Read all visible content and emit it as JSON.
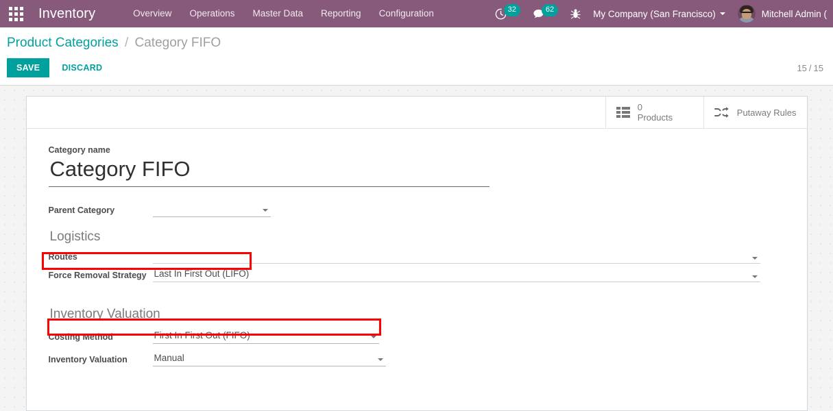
{
  "navbar": {
    "apps_icon": "apps-grid-icon",
    "brand": "Inventory",
    "menu": [
      {
        "label": "Overview"
      },
      {
        "label": "Operations"
      },
      {
        "label": "Master Data"
      },
      {
        "label": "Reporting"
      },
      {
        "label": "Configuration"
      }
    ],
    "tray": {
      "activities_icon": "clock-icon",
      "activities_count": "32",
      "messages_icon": "chat-bubble-icon",
      "messages_count": "62",
      "debug_icon": "bug-icon",
      "company": "My Company (San Francisco)",
      "user": "Mitchell Admin ("
    },
    "colors": {
      "navbar_bg": "#875A7B",
      "badge_bg": "#00A09D",
      "accent": "#00A09D"
    }
  },
  "control_panel": {
    "breadcrumb": {
      "parent": "Product Categories",
      "separator": "/",
      "current": "Category FIFO"
    },
    "save_label": "SAVE",
    "discard_label": "DISCARD",
    "pager": {
      "current": "15",
      "separator": "/",
      "total": "15"
    }
  },
  "smart_buttons": [
    {
      "icon": "list-icon",
      "value": "0",
      "label": "Products"
    },
    {
      "icon": "shuffle-icon",
      "label": "Putaway Rules"
    }
  ],
  "form": {
    "title_label": "Category name",
    "title_value": "Category FIFO",
    "parent_category": {
      "label": "Parent Category",
      "value": "",
      "placeholder": ""
    },
    "logistics": {
      "heading": "Logistics",
      "routes": {
        "label": "Routes",
        "value": "",
        "placeholder": ""
      },
      "force_removal_strategy": {
        "label": "Force Removal Strategy",
        "value": "Last In First Out (LIFO)",
        "external_link_icon": "external-link-icon"
      }
    },
    "inventory_valuation_group": {
      "heading": "Inventory Valuation",
      "costing_method": {
        "label": "Costing Method",
        "value": "First In First Out (FIFO)"
      },
      "inventory_valuation": {
        "label": "Inventory Valuation",
        "value": "Manual"
      }
    }
  },
  "annotations": {
    "highlight_color": "#FF0000",
    "boxes": [
      {
        "name": "force-removal-strategy-highlight"
      },
      {
        "name": "costing-method-highlight"
      }
    ]
  }
}
